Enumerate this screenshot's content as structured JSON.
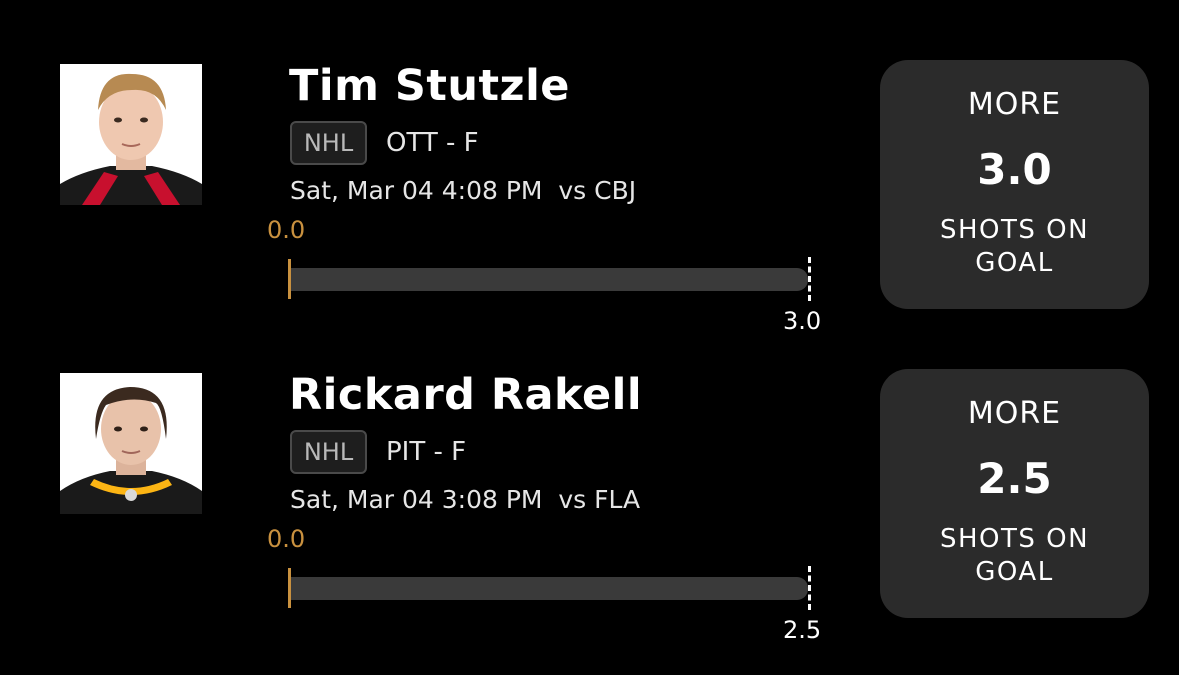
{
  "picks": [
    {
      "player": "Tim Stutzle",
      "league": "NHL",
      "team_position": "OTT - F",
      "game_time": "Sat, Mar 04 4:08 PM  vs CBJ",
      "current_value": "0.0",
      "target_value": "3.0",
      "progress_fraction": 0,
      "direction": "MORE",
      "line": "3.0",
      "stat": "SHOTS ON GOAL",
      "avatar_icon": "player-headshot-ottawa",
      "jersey_color": "#1a1a1a",
      "jersey_trim": "#c8102e"
    },
    {
      "player": "Rickard Rakell",
      "league": "NHL",
      "team_position": "PIT - F",
      "game_time": "Sat, Mar 04 3:08 PM  vs FLA",
      "current_value": "0.0",
      "target_value": "2.5",
      "progress_fraction": 0,
      "direction": "MORE",
      "line": "2.5",
      "stat": "SHOTS ON GOAL",
      "avatar_icon": "player-headshot-pittsburgh",
      "jersey_color": "#1a1a1a",
      "jersey_trim": "#fcb514"
    }
  ],
  "colors": {
    "background": "#000000",
    "card": "#2b2b2b",
    "accent": "#c9913f",
    "track": "#3a3a3a"
  }
}
